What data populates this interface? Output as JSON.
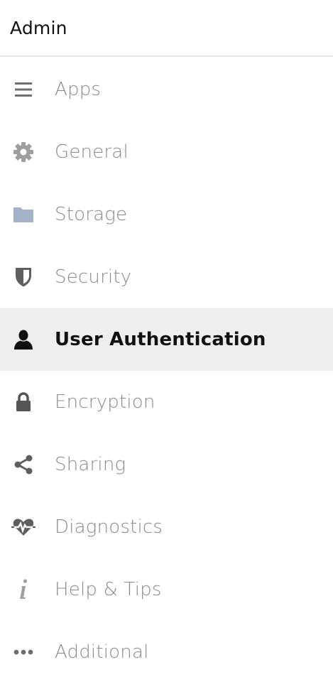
{
  "header": {
    "title": "Admin"
  },
  "menu": {
    "items": [
      {
        "label": "Apps",
        "icon": "list-icon"
      },
      {
        "label": "General",
        "icon": "gear-icon"
      },
      {
        "label": "Storage",
        "icon": "folder-icon"
      },
      {
        "label": "Security",
        "icon": "shield-icon"
      },
      {
        "label": "User Authentication",
        "icon": "user-icon",
        "active": true
      },
      {
        "label": "Encryption",
        "icon": "lock-icon"
      },
      {
        "label": "Sharing",
        "icon": "share-icon"
      },
      {
        "label": "Diagnostics",
        "icon": "heartbeat-icon"
      },
      {
        "label": "Help & Tips",
        "icon": "info-icon"
      },
      {
        "label": "Additional",
        "icon": "more-icon"
      }
    ]
  },
  "colors": {
    "active_background": "#eeeeee",
    "inactive_text": "#8a8a8a",
    "active_text": "#111111",
    "folder_icon": "#a3b2c8"
  }
}
